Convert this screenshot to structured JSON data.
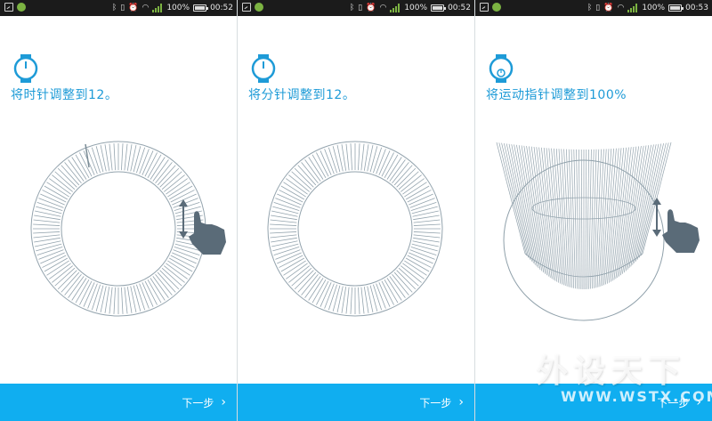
{
  "status_bar": {
    "battery": "100%",
    "icons": [
      "image-icon",
      "leaf-icon",
      "bluetooth-icon",
      "vibrate-icon",
      "alarm-icon",
      "wifi-icon",
      "signal-icon",
      "battery-icon"
    ]
  },
  "panels": [
    {
      "time": "00:52",
      "title": "将时针调整到12。",
      "next_label": "下一步",
      "chevron": "›",
      "icon": "watch-icon",
      "dial": "ring-with-hand-gesture"
    },
    {
      "time": "00:52",
      "title": "将分针调整到12。",
      "next_label": "下一步",
      "chevron": "›",
      "icon": "watch-icon",
      "dial": "ring"
    },
    {
      "time": "00:53",
      "title": "将运动指针调整到100%",
      "next_label": "下一步",
      "chevron": "›",
      "icon": "watch-sport-icon",
      "dial": "funnel-with-hand-gesture"
    }
  ],
  "watermark": {
    "text_cn": "外设天下",
    "text_url": "WWW.WSTX.COM"
  },
  "colors": {
    "accent": "#1e9bd7",
    "bottom_bar": "#10aef0",
    "status_bar": "#1b1b1b",
    "dial_line": "#93a3ad",
    "hand": "#5a6b78"
  }
}
